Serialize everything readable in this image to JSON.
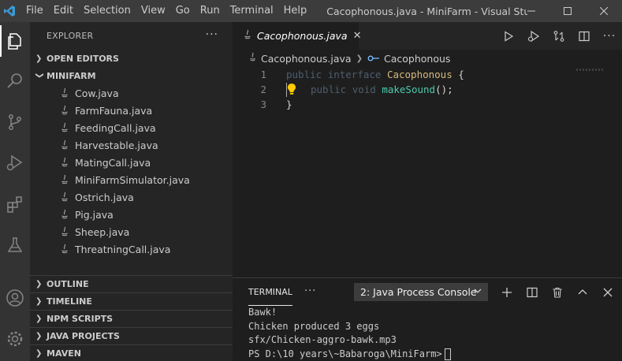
{
  "window": {
    "title": "Cacophonous.java - MiniFarm - Visual Studio ...",
    "menu": [
      "File",
      "Edit",
      "Selection",
      "View",
      "Go",
      "Run",
      "Terminal",
      "Help"
    ]
  },
  "colors": {
    "accent_logo": "#3c99d4",
    "activity_bar": "#333333",
    "sidebar": "#252526",
    "editor_bg": "#1e1e1e",
    "java_icon": "#a8a8a8"
  },
  "activitybar": {
    "items": [
      "explorer-icon",
      "search-icon",
      "source-control-icon",
      "run-debug-icon",
      "extensions-icon",
      "testing-icon"
    ],
    "bottom": [
      "account-icon",
      "settings-gear-icon"
    ]
  },
  "sidebar": {
    "header": "EXPLORER",
    "open_editors": "OPEN EDITORS",
    "project": "MINIFARM",
    "files": [
      "Cow.java",
      "FarmFauna.java",
      "FeedingCall.java",
      "Harvestable.java",
      "MatingCall.java",
      "MiniFarmSimulator.java",
      "Ostrich.java",
      "Pig.java",
      "Sheep.java",
      "ThreatningCall.java"
    ],
    "bottom_sections": [
      "OUTLINE",
      "TIMELINE",
      "NPM SCRIPTS",
      "JAVA PROJECTS",
      "MAVEN"
    ]
  },
  "editor": {
    "tab": "Cacophonous.java",
    "breadcrumb_file": "Cacophonous.java",
    "breadcrumb_symbol": "Cacophonous",
    "lines": [
      {
        "num": "1",
        "kw1": "public",
        "kw2": "interface",
        "name": "Cacophonous",
        "punc": " {"
      },
      {
        "num": "2",
        "kw1": "public",
        "kw2": "void",
        "name": "makeSound",
        "punc": "();"
      },
      {
        "num": "3",
        "punc": "}"
      }
    ]
  },
  "panel": {
    "tab": "TERMINAL",
    "terminal_select": "2: Java Process Console",
    "output": [
      "Bawk!",
      "Chicken produced 3 eggs",
      "sfx/Chicken-aggro-bawk.mp3",
      "PS D:\\10 years\\~Babaroga\\MiniFarm>"
    ]
  }
}
